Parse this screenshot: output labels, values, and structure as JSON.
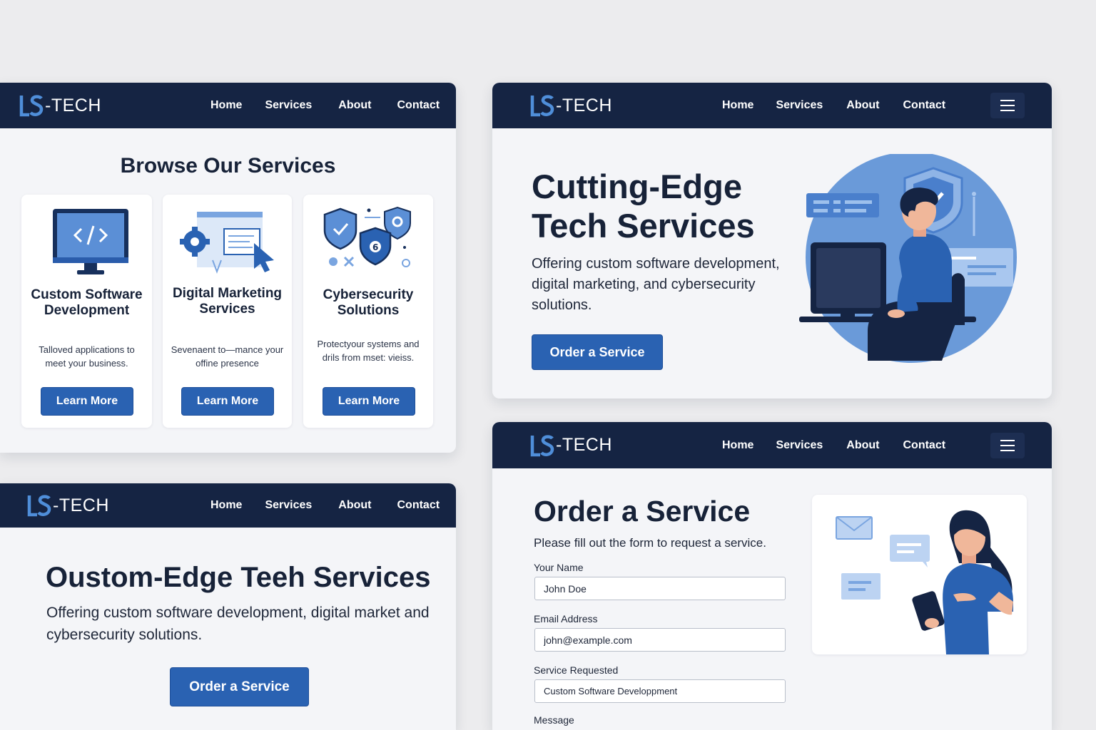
{
  "brand": {
    "logo_mark": "LS",
    "logo_text": "-TECH"
  },
  "nav": {
    "home": "Home",
    "services": "Services",
    "about": "About",
    "contact": "Contact"
  },
  "colors": {
    "navbar": "#152443",
    "accent": "#2a62b2",
    "page_bg": "#f4f5f8"
  },
  "services_panel": {
    "heading": "Browse Our Services",
    "cards": [
      {
        "icon": "code-monitor-icon",
        "title": "Custom Software Development",
        "description": "Talloved applications to meet your business.",
        "button": "Learn More"
      },
      {
        "icon": "marketing-gear-cursor-icon",
        "title": "Digital Marketing Services",
        "description": "Sevenaent to—mance your offine presence",
        "button": "Learn More"
      },
      {
        "icon": "security-shields-icon",
        "title": "Cybersecurity Solutions",
        "description": "Protectyour systems and drils from mset: vieiss.",
        "button": "Learn More"
      }
    ]
  },
  "hero_panel": {
    "title": "Cutting-Edge Tech Services",
    "subtitle": "Offering custom software development, digital marketing, and cybersecurity solutions.",
    "button": "Order a Service",
    "illustration": "person-at-computer-illustration"
  },
  "variant_panel": {
    "title": "Oustom-Edge Teeh Services",
    "subtitle": "Offering custom software development, digital market and cybersecurity solutions.",
    "button": "Order a Service"
  },
  "order_panel": {
    "title": "Order a Service",
    "subtitle": "Please fill out the form to request a service.",
    "fields": {
      "name": {
        "label": "Your Name",
        "value": "John Doe"
      },
      "email": {
        "label": "Email Address",
        "value": "john@example.com"
      },
      "service": {
        "label": "Service Requested",
        "value": "Custom Software Developpment"
      },
      "message": {
        "label": "Message"
      }
    },
    "illustration": "woman-with-tablet-illustration"
  }
}
